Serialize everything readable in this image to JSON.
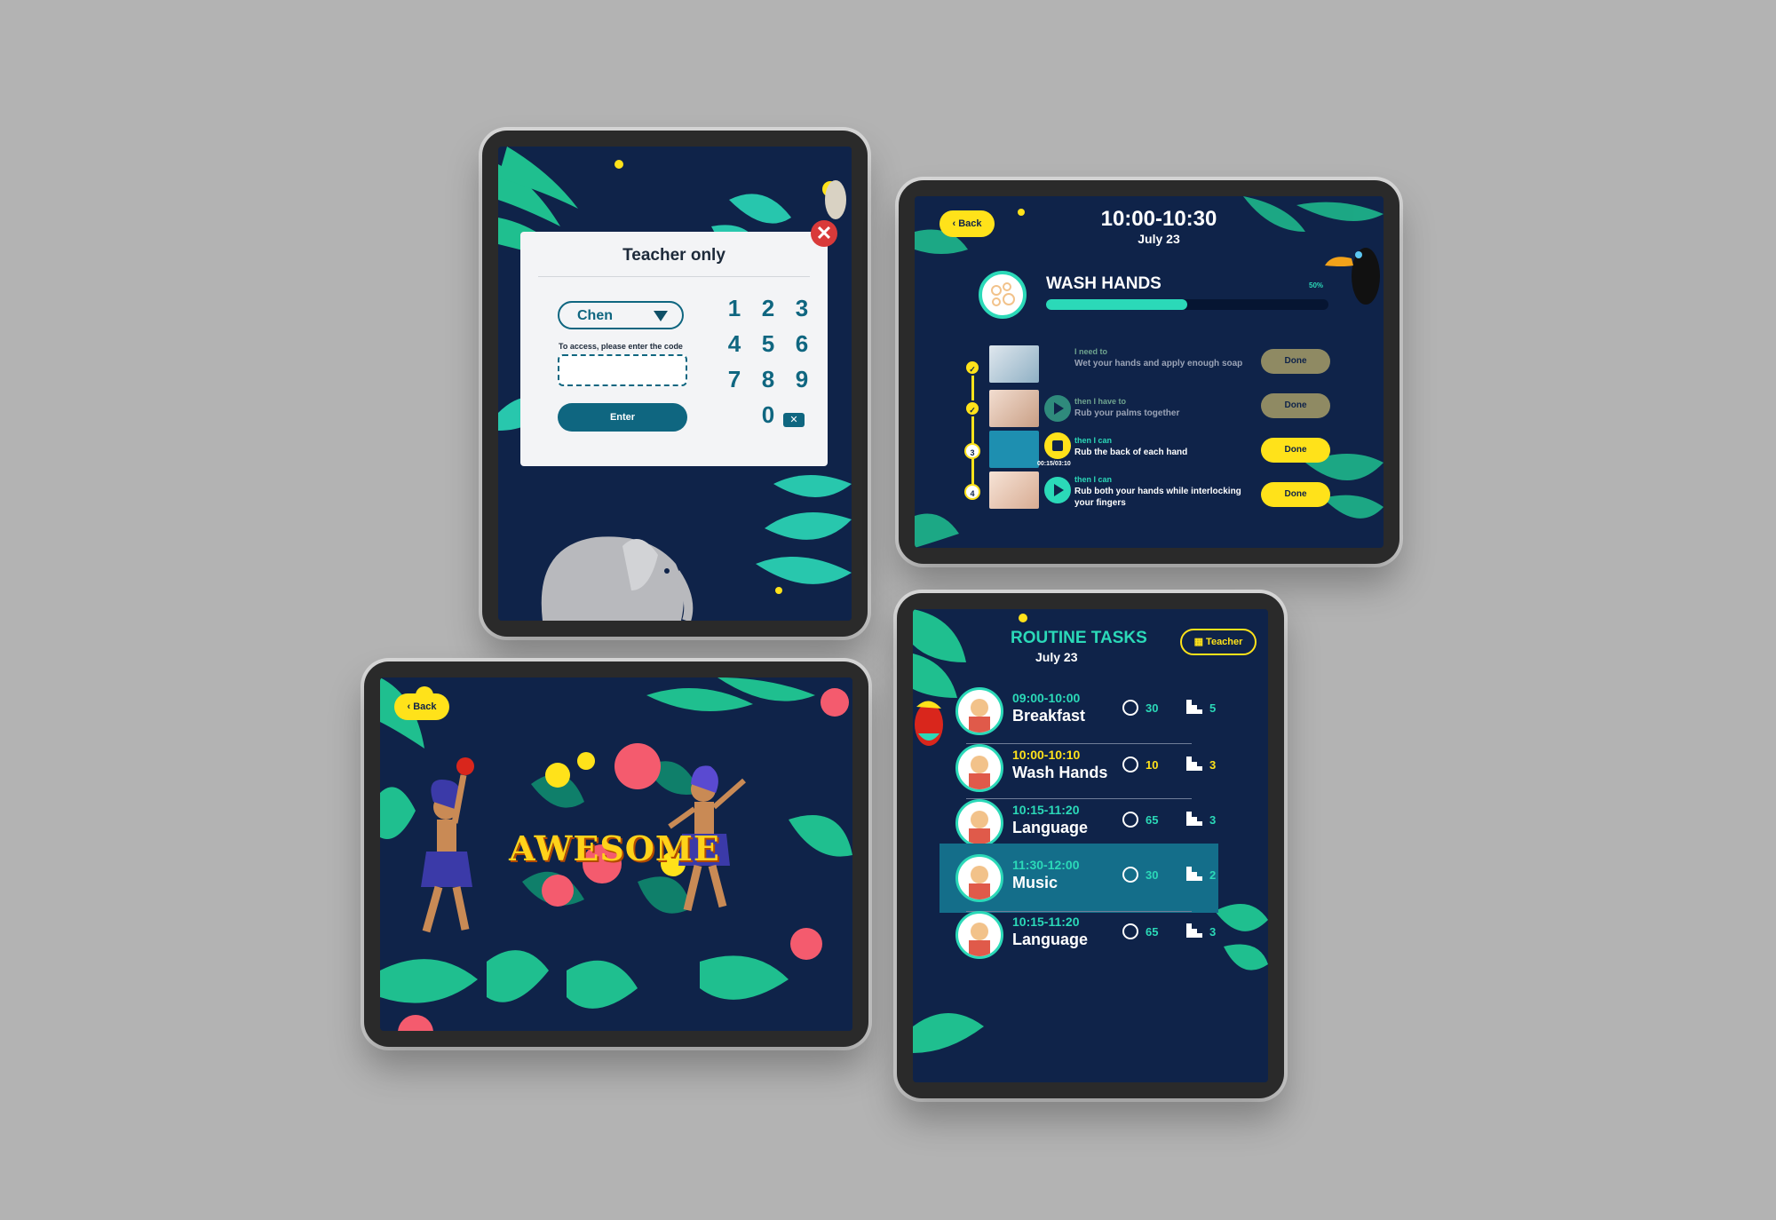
{
  "teacher_modal": {
    "title": "Teacher only",
    "user": "Chen",
    "hint": "To access, please enter the code",
    "code_value": "",
    "enter_label": "Enter",
    "close_symbol": "✕",
    "keys": [
      "1",
      "2",
      "3",
      "4",
      "5",
      "6",
      "7",
      "8",
      "9",
      "0"
    ],
    "backspace_symbol": "✕"
  },
  "wash": {
    "back_label": "Back",
    "time": "10:00-10:30",
    "date": "July 23",
    "task": "WASH HANDS",
    "progress_label": "50%",
    "progress": 0.5,
    "steps": [
      {
        "num": "✓",
        "pre": "I need to",
        "text": "Wet your hands and apply enough soap",
        "button": "Done",
        "state": "disabled",
        "play": false
      },
      {
        "num": "✓",
        "pre": "then I have to",
        "text": "Rub your palms together",
        "button": "Done",
        "state": "disabled",
        "play": "play-muted"
      },
      {
        "num": "3",
        "pre": "then I can",
        "text": "Rub the back of each hand",
        "button": "Done",
        "state": "active",
        "play": "stop",
        "timer": "00:15/03:10"
      },
      {
        "num": "4",
        "pre": "then I can",
        "text": "Rub both your hands while interlocking your fingers",
        "button": "Done",
        "state": "active",
        "play": "play"
      }
    ]
  },
  "awesome": {
    "back_label": "Back",
    "headline": "AWESOME"
  },
  "routine": {
    "title": "ROUTINE TASKS",
    "date": "July 23",
    "teacher_label": "Teacher",
    "rows": [
      {
        "time": "09:00-10:00",
        "name": "Breakfast",
        "minutes": "30",
        "steps": "5",
        "accent": "#2bd9b8",
        "selected": false
      },
      {
        "time": "10:00-10:10",
        "name": "Wash Hands",
        "minutes": "10",
        "steps": "3",
        "accent": "#ffe21a",
        "selected": false
      },
      {
        "time": "10:15-11:20",
        "name": "Language",
        "minutes": "65",
        "steps": "3",
        "accent": "#2bd9b8",
        "selected": false
      },
      {
        "time": "11:30-12:00",
        "name": "Music",
        "minutes": "30",
        "steps": "2",
        "accent": "#2bd9b8",
        "selected": true
      },
      {
        "time": "10:15-11:20",
        "name": "Language",
        "minutes": "65",
        "steps": "3",
        "accent": "#2bd9b8",
        "selected": false
      }
    ]
  },
  "colors": {
    "background": "#0f2349",
    "accent": "#2bd9b8",
    "yellow": "#ffe21a",
    "teal": "#0f6680"
  }
}
